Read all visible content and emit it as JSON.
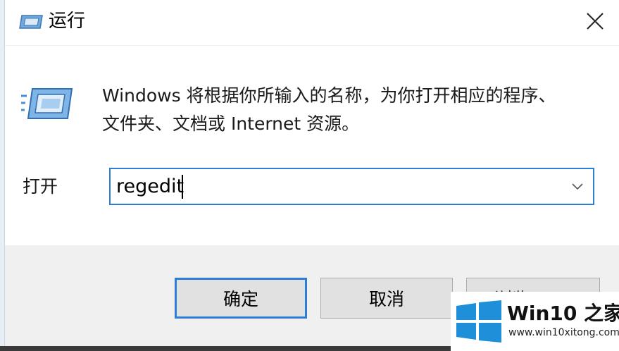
{
  "window": {
    "title": "运行",
    "close_icon": "close-icon",
    "app_icon": "run-dialog-icon"
  },
  "description": {
    "line1": "Windows 将根据你所输入的名称，为你打开相应的程序、",
    "line2": "文件夹、文档或 Internet 资源。"
  },
  "open_field": {
    "label": "打开",
    "value": "regedit",
    "dropdown_icon": "chevron-down-icon"
  },
  "buttons": {
    "ok_label": "确定",
    "cancel_label": "取消",
    "browse_label": "浏览(B)..."
  },
  "watermark": {
    "title": "Win10 之家",
    "url": "www.win10xitong.com",
    "logo_icon": "windows-logo-icon"
  },
  "colors": {
    "accent": "#2d7fd6",
    "footer_bg": "#f0f0f0",
    "button_bg": "#e1e1e1",
    "windows_blue": "#1e8fd8"
  }
}
